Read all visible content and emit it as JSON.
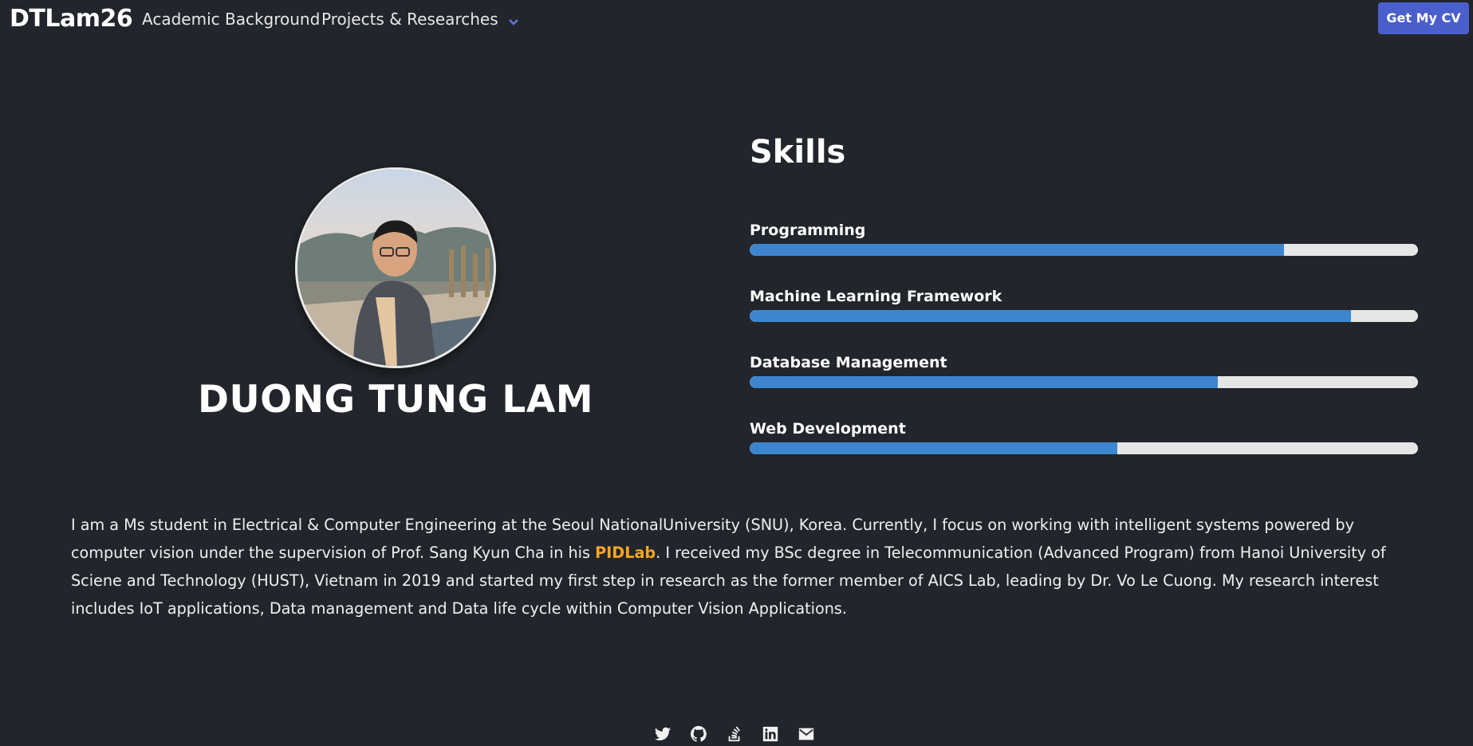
{
  "nav": {
    "brand": "DTLam26",
    "links": [
      "Academic Background",
      "Projects & Researches"
    ],
    "cv_button": "Get My CV"
  },
  "profile": {
    "name": "DUONG TUNG LAM"
  },
  "skills": {
    "title": "Skills",
    "items": [
      {
        "label": "Programming",
        "level": 0.8
      },
      {
        "label": "Machine Learning Framework",
        "level": 0.9
      },
      {
        "label": "Database Management",
        "level": 0.7
      },
      {
        "label": "Web Development",
        "level": 0.55
      }
    ]
  },
  "bio": {
    "part1": "I am a Ms student in Electrical & Computer Engineering at the Seoul NationalUniversity (SNU), Korea. Currently, I focus on working with intelligent systems powered by computer vision under the supervision of Prof. Sang Kyun Cha in his ",
    "link": "PIDLab",
    "part2": ". I received my BSc degree in Telecommunication (Advanced Program) from Hanoi University of Sciene and Technology (HUST), Vietnam in 2019 and started my first step in research as the former member of AICS Lab, leading by Dr. Vo Le Cuong. My research interest includes IoT applications, Data management and Data life cycle within Computer Vision Applications."
  },
  "socials": [
    "twitter-icon",
    "github-icon",
    "stackoverflow-icon",
    "linkedin-icon",
    "email-icon"
  ],
  "colors": {
    "background": "#22252b",
    "accent_button": "#4a5fcb",
    "bar_fill": "#3d85cf",
    "bar_track": "#e6e6e6",
    "link": "#f5a623"
  }
}
